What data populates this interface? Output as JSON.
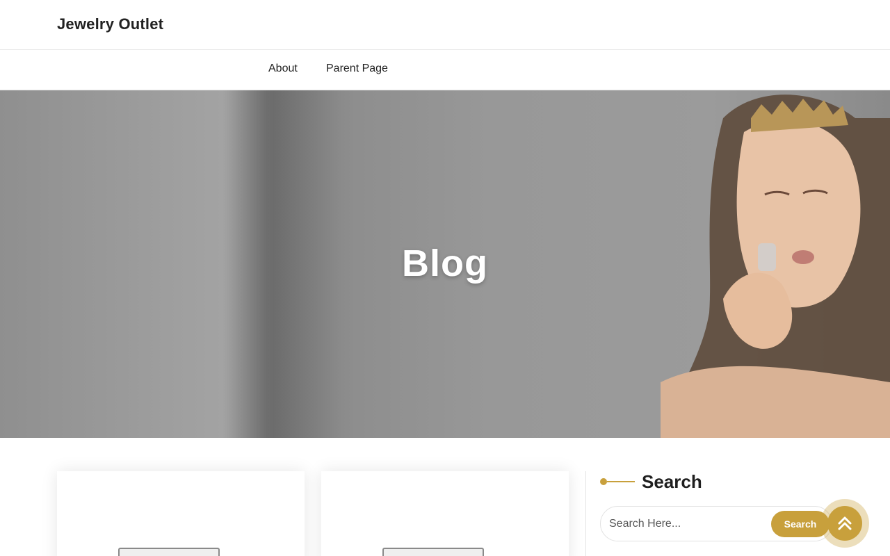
{
  "header": {
    "site_title": "Jewelry Outlet"
  },
  "nav": {
    "items": [
      {
        "label": "About"
      },
      {
        "label": "Parent Page"
      }
    ]
  },
  "hero": {
    "title": "Blog"
  },
  "sidebar": {
    "search_widget": {
      "title": "Search",
      "placeholder": "Search Here...",
      "button_label": "Search"
    }
  },
  "colors": {
    "accent": "#c8a03c",
    "text": "#1f1f1f",
    "border": "#e6e6e6"
  },
  "icons": {
    "scroll_top": "double-chevron-up-icon"
  }
}
